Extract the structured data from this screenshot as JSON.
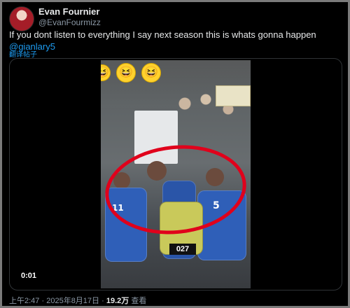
{
  "user": {
    "name": "Evan Fournier",
    "handle": "@EvanFourmizz"
  },
  "tweet": {
    "text_main": "If you dont listen to everything I say next season this is whats gonna happen ",
    "mention": "@gianlary5",
    "translate": "翻译帖子"
  },
  "media": {
    "timestamp": "0:01",
    "jersey_numbers": {
      "left": "11",
      "center": "5",
      "vest": "027"
    },
    "highlight_color": "#e0001b",
    "emoji_icons": [
      "laughing-emoji",
      "laughing-emoji",
      "laughing-emoji"
    ]
  },
  "meta": {
    "time": "上午2:47",
    "sep1": "·",
    "date": "2025年8月17日",
    "sep2": "·",
    "views_count": "19.2万",
    "views_label": "查看"
  },
  "colors": {
    "accent": "#1d9bf0",
    "text": "#e7e9ea",
    "muted": "#8b98a5",
    "background": "#000000"
  }
}
